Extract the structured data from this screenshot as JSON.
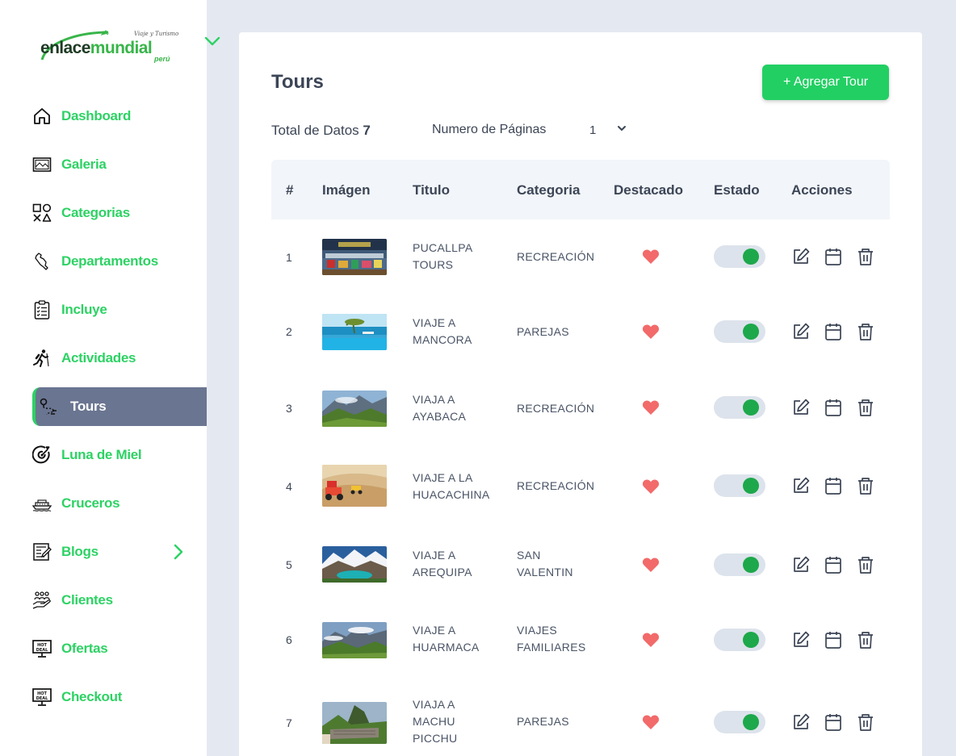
{
  "brand": {
    "tagline": "Viaje y Turismo",
    "name_part1": "enlace",
    "name_part2": "mundial",
    "country": "perú"
  },
  "colors": {
    "accent": "#22cf63",
    "nav_text": "#2dd264",
    "active_bg": "#6a7591",
    "heart": "#f26a6a",
    "toggle_on": "#1da84b",
    "page_bg": "#e4e9f1"
  },
  "sidebar": {
    "items": [
      {
        "label": "Dashboard",
        "icon": "home-icon"
      },
      {
        "label": "Galeria",
        "icon": "gallery-icon"
      },
      {
        "label": "Categorias",
        "icon": "categories-icon"
      },
      {
        "label": "Departamentos",
        "icon": "map-peru-icon"
      },
      {
        "label": "Incluye",
        "icon": "clipboard-list-icon"
      },
      {
        "label": "Actividades",
        "icon": "hiker-icon"
      },
      {
        "label": "Tours",
        "icon": "route-icon",
        "active": true
      },
      {
        "label": "Luna de Miel",
        "icon": "target-heart-icon"
      },
      {
        "label": "Cruceros",
        "icon": "cruise-ship-icon"
      },
      {
        "label": "Blogs",
        "icon": "blog-icon",
        "has_submenu": true
      },
      {
        "label": "Clientes",
        "icon": "hand-people-icon"
      },
      {
        "label": "Ofertas",
        "icon": "hot-deal-icon"
      },
      {
        "label": "Checkout",
        "icon": "hot-deal-icon"
      }
    ]
  },
  "main": {
    "title": "Tours",
    "add_button": "+ Agregar Tour",
    "total_label": "Total de Datos",
    "total_value": "7",
    "pages_label": "Numero de Páginas",
    "pages_value": "1"
  },
  "table": {
    "headers": [
      "#",
      "Imágen",
      "Titulo",
      "Categoria",
      "Destacado",
      "Estado",
      "Acciones"
    ],
    "rows": [
      {
        "num": "1",
        "title": "PUCALLPA\nTOURS",
        "category": "RECREACIÓN",
        "featured": true,
        "active": true,
        "image": "river-boats-photo"
      },
      {
        "num": "2",
        "title": "VIAJE A\nMANCORA",
        "category": "PAREJAS",
        "featured": true,
        "active": true,
        "image": "beach-pool-photo"
      },
      {
        "num": "3",
        "title": "VIAJA A\nAYABACA",
        "category": "RECREACIÓN",
        "featured": true,
        "active": true,
        "image": "mountain-valley-photo"
      },
      {
        "num": "4",
        "title": "VIAJE A LA\nHUACACHINA",
        "category": "RECREACIÓN",
        "featured": true,
        "active": true,
        "image": "desert-buggy-photo"
      },
      {
        "num": "5",
        "title": "VIAJE A\nAREQUIPA",
        "category": "SAN\nVALENTIN",
        "featured": true,
        "active": true,
        "image": "lagoon-peaks-photo"
      },
      {
        "num": "6",
        "title": "VIAJE A\nHUARMACA",
        "category": "VIAJES\nFAMILIARES",
        "featured": true,
        "active": true,
        "image": "cloudy-mountain-photo"
      },
      {
        "num": "7",
        "title": "VIAJA A\nMACHU\nPICCHU",
        "category": "PAREJAS",
        "featured": true,
        "active": true,
        "image": "machu-picchu-photo"
      }
    ]
  }
}
